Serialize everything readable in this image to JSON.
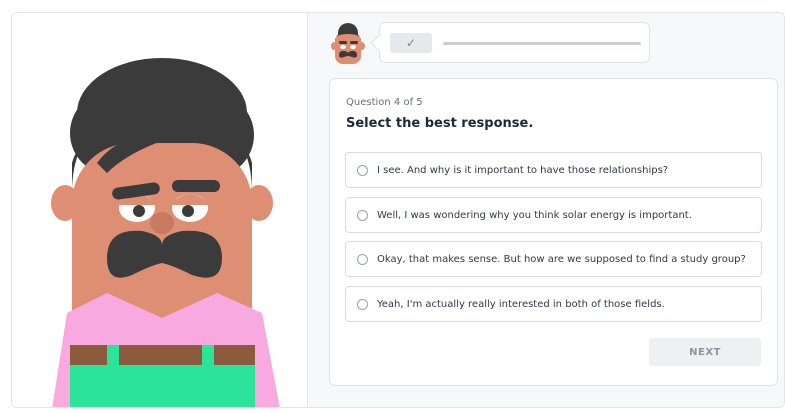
{
  "progress": {
    "check_icon": "✓",
    "check_icon_name": "checkmark-icon"
  },
  "question": {
    "number_label": "Question 4 of 5",
    "prompt": "Select the best response."
  },
  "options": [
    {
      "text": "I see. And why is it important to have those relationships?"
    },
    {
      "text": "Well, I was wondering why you think solar energy is important."
    },
    {
      "text": "Okay, that makes sense. But how are we supposed to find a study group?"
    },
    {
      "text": "Yeah, I'm actually really interested in both of those fields."
    }
  ],
  "next_button": {
    "label": "NEXT"
  },
  "colors": {
    "skin": "#de8f73",
    "hair": "#3b3b3b",
    "shirt": "#f8a9df",
    "belt": "#8c5a3c",
    "pants": "#2be399",
    "eye_white": "#ffffff"
  }
}
